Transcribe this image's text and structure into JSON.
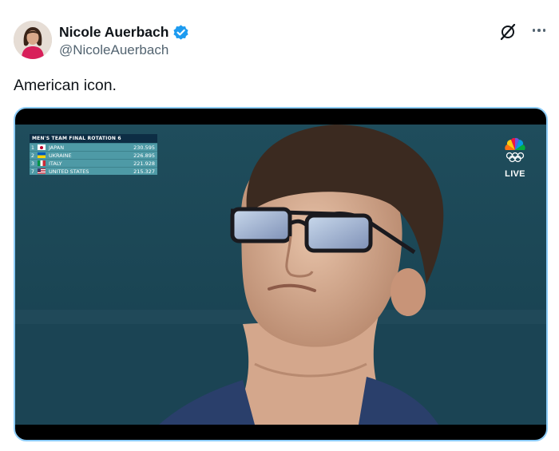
{
  "author": {
    "display_name": "Nicole Auerbach",
    "handle": "@NicoleAuerbach",
    "verified": true
  },
  "icons": {
    "grok": "grok-icon",
    "more": "more-icon",
    "verified": "verified-badge-icon"
  },
  "tweet": {
    "text": "American icon."
  },
  "broadcast": {
    "title": "MEN'S TEAM FINAL ROTATION 6",
    "standings": [
      {
        "rank": "1",
        "country": "JAPAN",
        "score": "230.595",
        "flag": "japan"
      },
      {
        "rank": "2",
        "country": "UKRAINE",
        "score": "226.895",
        "flag": "ukraine"
      },
      {
        "rank": "3",
        "country": "ITALY",
        "score": "221.928",
        "flag": "italy"
      },
      {
        "rank": "7",
        "country": "UNITED STATES",
        "score": "215.327",
        "flag": "usa"
      }
    ],
    "live_label": "LIVE"
  },
  "colors": {
    "verified_blue": "#1d9bf0",
    "media_border": "#8ecdf8",
    "scoreboard_header": "#0d2d44",
    "scoreboard_row": "#4e9aa6"
  }
}
